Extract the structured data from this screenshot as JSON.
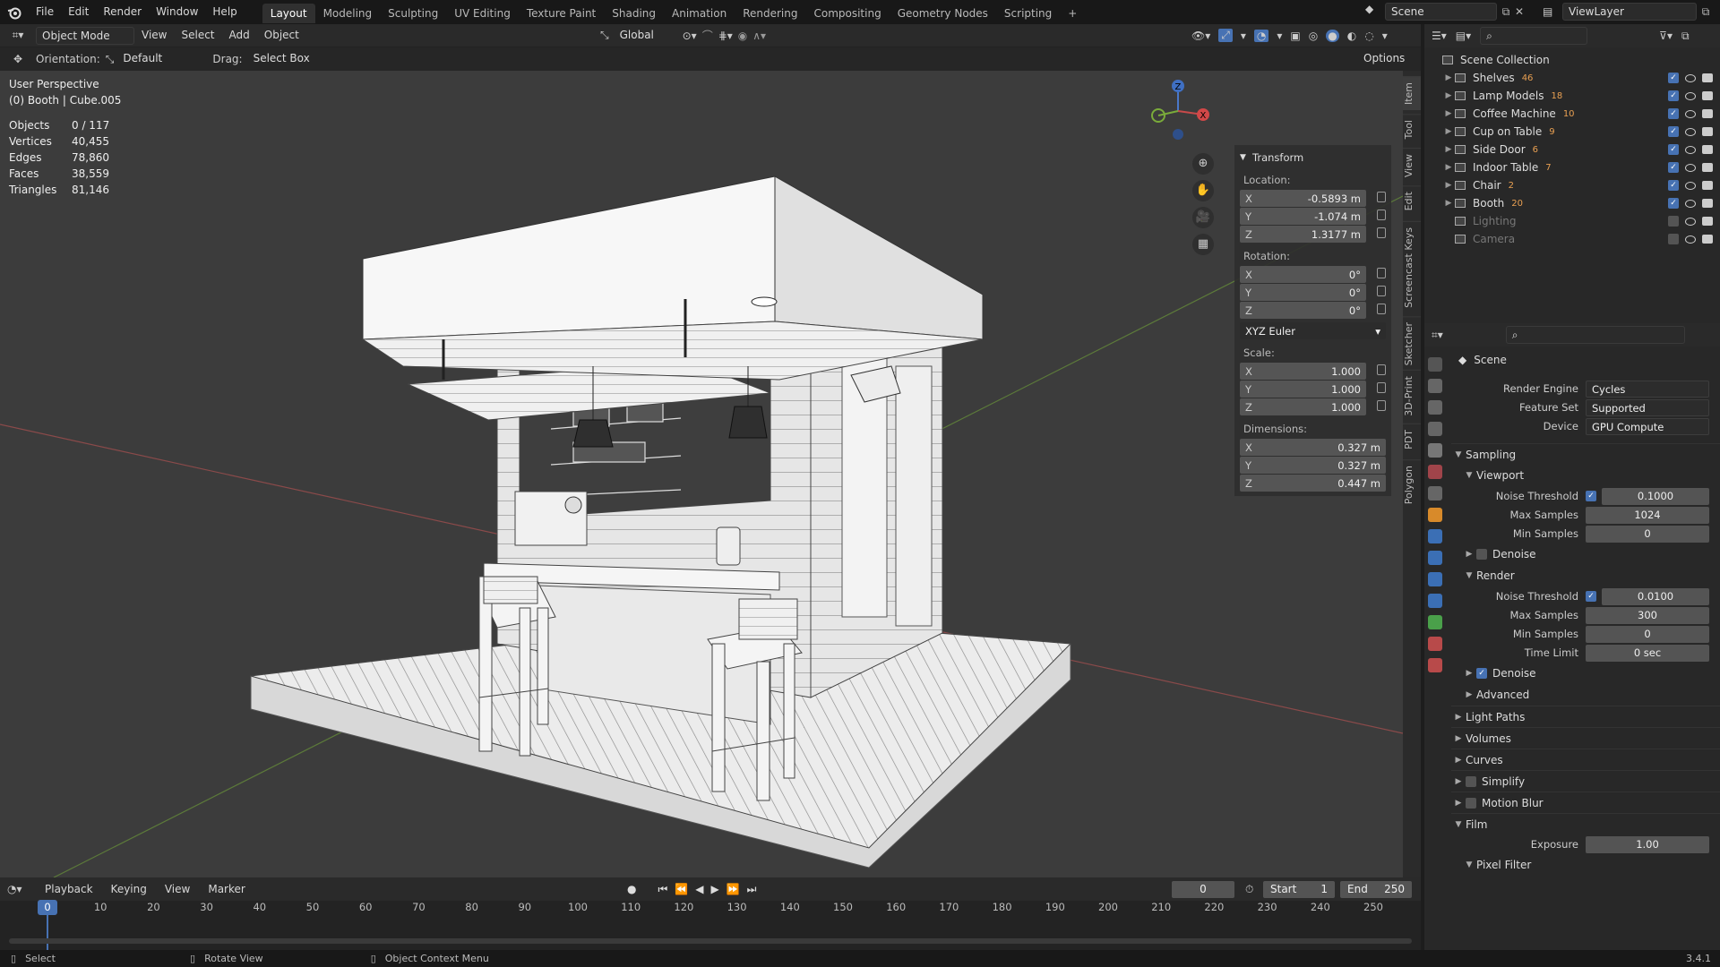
{
  "topbar": {
    "menus": [
      "File",
      "Edit",
      "Render",
      "Window",
      "Help"
    ],
    "workspaces": [
      "Layout",
      "Modeling",
      "Sculpting",
      "UV Editing",
      "Texture Paint",
      "Shading",
      "Animation",
      "Rendering",
      "Compositing",
      "Geometry Nodes",
      "Scripting"
    ],
    "add_tab": "+",
    "scene": "Scene",
    "viewlayer": "ViewLayer"
  },
  "viewport_header": {
    "mode": "Object Mode",
    "menus": [
      "View",
      "Select",
      "Add",
      "Object"
    ],
    "transform_orientation": "Global",
    "options": "Options"
  },
  "tool_header": {
    "orientation_label": "Orientation:",
    "orientation_value": "Default",
    "drag_label": "Drag:",
    "drag_value": "Select Box"
  },
  "viewport": {
    "view_name": "User Perspective",
    "object_name": "(0) Booth | Cube.005",
    "stats": [
      {
        "key": "Objects",
        "value": "0 / 117"
      },
      {
        "key": "Vertices",
        "value": "40,455"
      },
      {
        "key": "Edges",
        "value": "78,860"
      },
      {
        "key": "Faces",
        "value": "38,559"
      },
      {
        "key": "Triangles",
        "value": "81,146"
      }
    ],
    "gizmo_labels": {
      "x": "X",
      "y": "Y",
      "z": "Z"
    }
  },
  "npanel": {
    "title": "Transform",
    "location_label": "Location:",
    "location": [
      {
        "axis": "X",
        "value": "-0.5893 m"
      },
      {
        "axis": "Y",
        "value": "-1.074 m"
      },
      {
        "axis": "Z",
        "value": "1.3177 m"
      }
    ],
    "rotation_label": "Rotation:",
    "rotation": [
      {
        "axis": "X",
        "value": "0°"
      },
      {
        "axis": "Y",
        "value": "0°"
      },
      {
        "axis": "Z",
        "value": "0°"
      }
    ],
    "rotation_mode": "XYZ Euler",
    "scale_label": "Scale:",
    "scale": [
      {
        "axis": "X",
        "value": "1.000"
      },
      {
        "axis": "Y",
        "value": "1.000"
      },
      {
        "axis": "Z",
        "value": "1.000"
      }
    ],
    "dimensions_label": "Dimensions:",
    "dimensions": [
      {
        "axis": "X",
        "value": "0.327 m"
      },
      {
        "axis": "Y",
        "value": "0.327 m"
      },
      {
        "axis": "Z",
        "value": "0.447 m"
      }
    ],
    "side_tabs": [
      "Item",
      "Tool",
      "View",
      "Edit",
      "Screencast Keys",
      "Sketcher",
      "3D-Print",
      "PDT",
      "Polygon"
    ]
  },
  "outliner": {
    "root": "Scene Collection",
    "items": [
      {
        "name": "Shelves",
        "count": "46",
        "enabled": true
      },
      {
        "name": "Lamp Models",
        "count": "18",
        "enabled": true
      },
      {
        "name": "Coffee Machine",
        "count": "10",
        "enabled": true
      },
      {
        "name": "Cup on Table",
        "count": "9",
        "enabled": true
      },
      {
        "name": "Side Door",
        "count": "6",
        "enabled": true
      },
      {
        "name": "Indoor Table",
        "count": "7",
        "enabled": true
      },
      {
        "name": "Chair",
        "count": "2",
        "enabled": true
      },
      {
        "name": "Booth",
        "count": "20",
        "enabled": true
      },
      {
        "name": "Lighting",
        "count": "",
        "enabled": false
      },
      {
        "name": "Camera",
        "count": "",
        "enabled": false
      }
    ]
  },
  "properties": {
    "context": "Scene",
    "render_engine_label": "Render Engine",
    "render_engine": "Cycles",
    "feature_set_label": "Feature Set",
    "feature_set": "Supported",
    "device_label": "Device",
    "device": "GPU Compute",
    "sampling": "Sampling",
    "viewport": "Viewport",
    "vp_noise_label": "Noise Threshold",
    "vp_noise": "0.1000",
    "vp_max_label": "Max Samples",
    "vp_max": "1024",
    "vp_min_label": "Min Samples",
    "vp_min": "0",
    "vp_denoise": "Denoise",
    "render": "Render",
    "r_noise_label": "Noise Threshold",
    "r_noise": "0.0100",
    "r_max_label": "Max Samples",
    "r_max": "300",
    "r_min_label": "Min Samples",
    "r_min": "0",
    "r_time_label": "Time Limit",
    "r_time": "0 sec",
    "r_denoise": "Denoise",
    "advanced": "Advanced",
    "light_paths": "Light Paths",
    "volumes": "Volumes",
    "curves": "Curves",
    "simplify": "Simplify",
    "motion_blur": "Motion Blur",
    "film": "Film",
    "exposure_label": "Exposure",
    "exposure": "1.00",
    "pixel_filter": "Pixel Filter"
  },
  "timeline": {
    "menus": [
      "Playback",
      "Keying",
      "View",
      "Marker"
    ],
    "current_frame": "0",
    "start_label": "Start",
    "start": "1",
    "end_label": "End",
    "end": "250",
    "ticks": [
      "0",
      "10",
      "20",
      "30",
      "40",
      "50",
      "60",
      "70",
      "80",
      "90",
      "100",
      "110",
      "120",
      "130",
      "140",
      "150",
      "160",
      "170",
      "180",
      "190",
      "200",
      "210",
      "220",
      "230",
      "240",
      "250"
    ]
  },
  "statusbar": {
    "select": "Select",
    "rotate": "Rotate View",
    "context_menu": "Object Context Menu",
    "version": "3.4.1"
  }
}
